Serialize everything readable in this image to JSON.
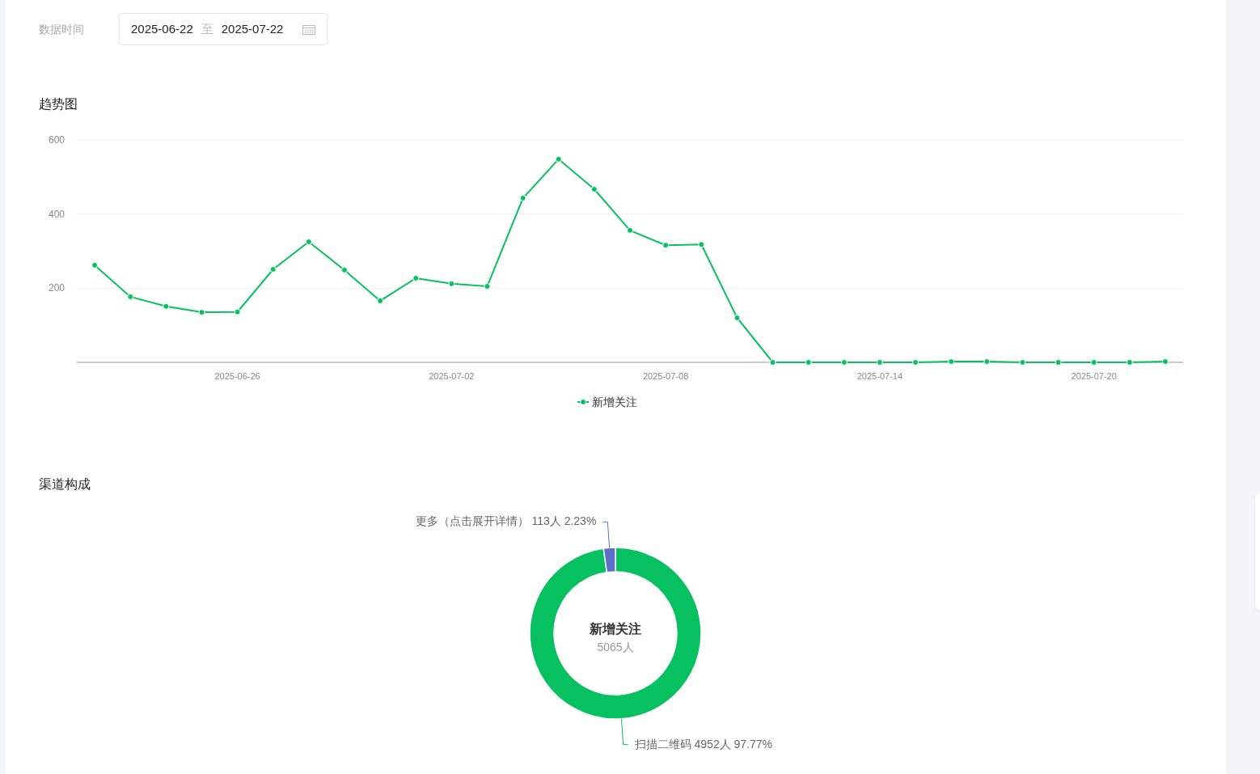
{
  "filter": {
    "label": "数据时间",
    "start": "2025-06-22",
    "separator": "至",
    "end": "2025-07-22"
  },
  "trend": {
    "title": "趋势图",
    "chart_data": {
      "type": "line",
      "categories": [
        null,
        null,
        null,
        null,
        "2025-06-26",
        null,
        null,
        null,
        null,
        null,
        "2025-07-02",
        null,
        null,
        null,
        null,
        null,
        "2025-07-08",
        null,
        null,
        null,
        null,
        null,
        "2025-07-14",
        null,
        null,
        null,
        null,
        null,
        "2025-07-20",
        null,
        null
      ],
      "series": [
        {
          "name": "新增关注",
          "color": "#07c160",
          "marker": "circle",
          "values": [
            262,
            177,
            151,
            135,
            136,
            251,
            325,
            249,
            166,
            227,
            212,
            205,
            443,
            548,
            467,
            356,
            316,
            318,
            120,
            0,
            0,
            0,
            0,
            0,
            2,
            2,
            0,
            0,
            0,
            0,
            2
          ]
        }
      ],
      "ylim": [
        0,
        600
      ],
      "yticks": [
        200,
        400,
        600
      ]
    }
  },
  "channels": {
    "title": "渠道构成",
    "center_value": "5065人",
    "chart_data": {
      "type": "donut",
      "categories": [
        "扫描二维码",
        "更多（点击展开详情）"
      ],
      "series": [
        {
          "name": "新增关注",
          "values": [
            97.77,
            2.23
          ]
        }
      ],
      "colors": [
        "#07c160",
        "#5b6fc8"
      ],
      "value_labels": [
        "4952人 97.77%",
        "113人 2.23%"
      ]
    }
  }
}
